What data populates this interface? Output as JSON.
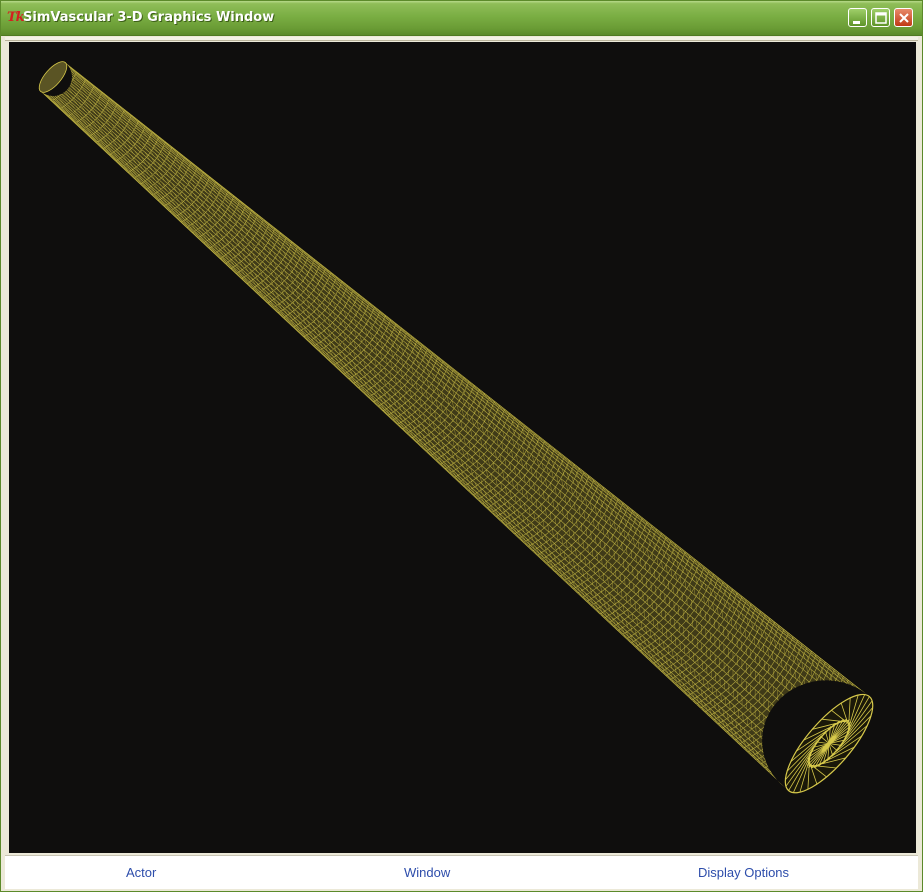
{
  "window": {
    "icon_text": "Tk",
    "title": "SimVascular 3-D Graphics Window",
    "controls": {
      "minimize": "minimize-icon",
      "maximize": "maximize-icon",
      "close": "close-icon"
    }
  },
  "viewport": {
    "background_color": "#0f0e0d",
    "mesh_color": "#d6c84a",
    "render": "wireframe-cylinder-mesh"
  },
  "menu": {
    "items": [
      "Actor",
      "Window",
      "Display Options"
    ]
  }
}
